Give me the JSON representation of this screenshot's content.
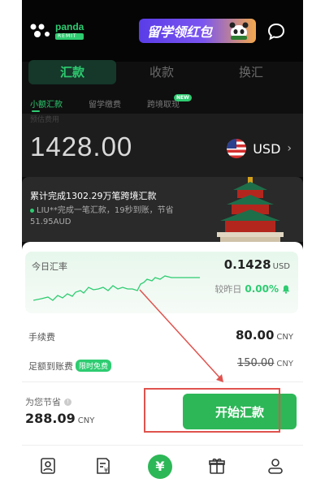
{
  "header": {
    "logo_name": "panda",
    "logo_sub": "REMIT",
    "promo_text": "留学领红包"
  },
  "tabs": [
    {
      "label": "汇款",
      "active": true
    },
    {
      "label": "收款",
      "active": false
    },
    {
      "label": "换汇",
      "active": false
    }
  ],
  "subtabs": [
    {
      "label": "小额汇款",
      "active": true
    },
    {
      "label": "留学缴费",
      "active": false
    },
    {
      "label": "跨境取现",
      "active": false,
      "badge": "NEW"
    }
  ],
  "amount": {
    "hint": "预估费用",
    "value": "1428.00",
    "currency": "USD"
  },
  "banner": {
    "title": "累计完成1302.29万笔跨境汇款",
    "detail": "LIU**完成一笔汇款，19秒到账，节省51.95AUD"
  },
  "rate": {
    "label": "今日汇率",
    "value": "0.1428",
    "unit": "USD",
    "change_label": "较昨日",
    "change_value": "0.00%"
  },
  "fee": {
    "label": "手续费",
    "value": "80.00",
    "unit": "CNY"
  },
  "full_amount": {
    "label": "足额到账费",
    "badge": "限时免费",
    "value": "150.00",
    "unit": "CNY"
  },
  "savings": {
    "label": "为您节省",
    "value": "288.09",
    "unit": "CNY"
  },
  "action": {
    "send_label": "开始汇款"
  },
  "nav": {
    "center_symbol": "¥"
  },
  "colors": {
    "accent": "#2ecc71",
    "button": "#2db757",
    "highlight": "#e0534e"
  }
}
